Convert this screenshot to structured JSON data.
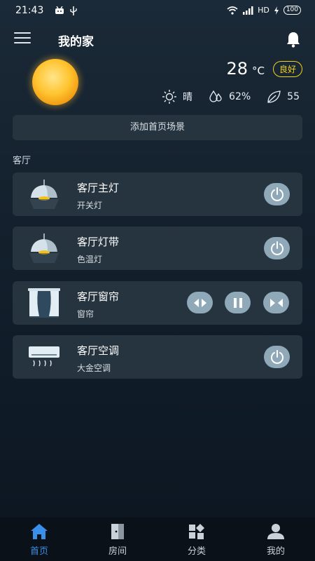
{
  "status": {
    "time": "21:43",
    "network": "HD",
    "battery": "100"
  },
  "header": {
    "title": "我的家"
  },
  "weather": {
    "temperature": "28",
    "unit": "°C",
    "air_quality": "良好",
    "condition": "晴",
    "humidity": "62%",
    "aqi_value": "55"
  },
  "add_scene_label": "添加首页场景",
  "room": {
    "name": "客厅"
  },
  "devices": [
    {
      "name": "客厅主灯",
      "type": "开关灯",
      "icon": "ceiling-lamp-icon"
    },
    {
      "name": "客厅灯带",
      "type": "色温灯",
      "icon": "ceiling-lamp-icon"
    },
    {
      "name": "客厅窗帘",
      "type": "窗帘",
      "icon": "curtain-icon"
    },
    {
      "name": "客厅空调",
      "type": "大金空调",
      "icon": "air-conditioner-icon"
    }
  ],
  "tabs": [
    {
      "label": "首页",
      "icon": "home-icon",
      "active": true
    },
    {
      "label": "房间",
      "icon": "door-icon",
      "active": false
    },
    {
      "label": "分类",
      "icon": "category-icon",
      "active": false
    },
    {
      "label": "我的",
      "icon": "user-icon",
      "active": false
    }
  ],
  "colors": {
    "accent": "#3a8fe8",
    "badge": "#f2d21a",
    "card": "#26343f",
    "button": "#8fa9b9"
  }
}
